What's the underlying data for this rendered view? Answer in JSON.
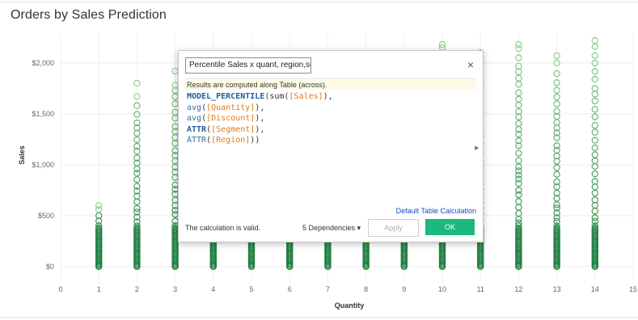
{
  "chart_data": {
    "type": "scatter",
    "title": "Orders by Sales Prediction",
    "xlabel": "Quantity",
    "ylabel": "Sales",
    "xlim": [
      0,
      15
    ],
    "ylim": [
      -80,
      2300
    ],
    "x_ticks": [
      0,
      1,
      2,
      3,
      4,
      5,
      6,
      7,
      8,
      9,
      10,
      11,
      12,
      13,
      14,
      15
    ],
    "x_tick_labels": [
      "0",
      "1",
      "2",
      "3",
      "4",
      "5",
      "6",
      "7",
      "8",
      "9",
      "10",
      "11",
      "12",
      "13",
      "14",
      "15"
    ],
    "y_ticks": [
      0,
      500,
      1000,
      1500,
      2000
    ],
    "y_tick_labels": [
      "$0",
      "$500",
      "$1,000",
      "$1,500",
      "$2,000"
    ],
    "grid": true,
    "colors": {
      "low": "#1a7a3e",
      "high": "#8fd18b"
    },
    "columns": [
      {
        "x": 1,
        "max": 600,
        "outliers": [
          560,
          600
        ]
      },
      {
        "x": 2,
        "max": 1800,
        "outliers": [
          1670,
          1800
        ]
      },
      {
        "x": 3,
        "max": 1920,
        "outliers": [
          1780,
          1920
        ]
      },
      {
        "x": 4,
        "max": 350,
        "outliers": []
      },
      {
        "x": 5,
        "max": 350,
        "outliers": []
      },
      {
        "x": 6,
        "max": 350,
        "outliers": []
      },
      {
        "x": 7,
        "max": 350,
        "outliers": []
      },
      {
        "x": 8,
        "max": 350,
        "outliers": []
      },
      {
        "x": 9,
        "max": 350,
        "outliers": []
      },
      {
        "x": 10,
        "max": 2180,
        "outliers": [
          2150,
          2180
        ]
      },
      {
        "x": 11,
        "max": 2100,
        "outliers": [
          2050,
          2100
        ]
      },
      {
        "x": 12,
        "max": 2180,
        "outliers": [
          2140,
          2180
        ]
      },
      {
        "x": 13,
        "max": 2070,
        "outliers": [
          2000,
          2070
        ]
      },
      {
        "x": 14,
        "max": 2220,
        "outliers": [
          2220
        ]
      }
    ]
  },
  "dialog": {
    "calc_name": "Percentile Sales x quant, region,seg",
    "close": "×",
    "note": "Results are computed along Table (across).",
    "code_lines": [
      {
        "a": "MODEL_PERCENTILE",
        "b": "(sum(",
        "c": "[Sales]",
        "d": "),"
      },
      {
        "a": "avg",
        "b": "(",
        "c": "[Quantity]",
        "d": "),"
      },
      {
        "a": "avg",
        "b": "(",
        "c": "[Discount]",
        "d": "),"
      },
      {
        "a": "ATTR",
        "b": "(",
        "c": "[Segment]",
        "d": "),"
      },
      {
        "a": "ATTR",
        "b": "(",
        "c": "[Region]",
        "d": "))"
      }
    ],
    "default_link": "Default Table Calculation",
    "valid_text": "The calculation is valid.",
    "dependencies": "5 Dependencies ▾",
    "apply": "Apply",
    "ok": "OK"
  }
}
